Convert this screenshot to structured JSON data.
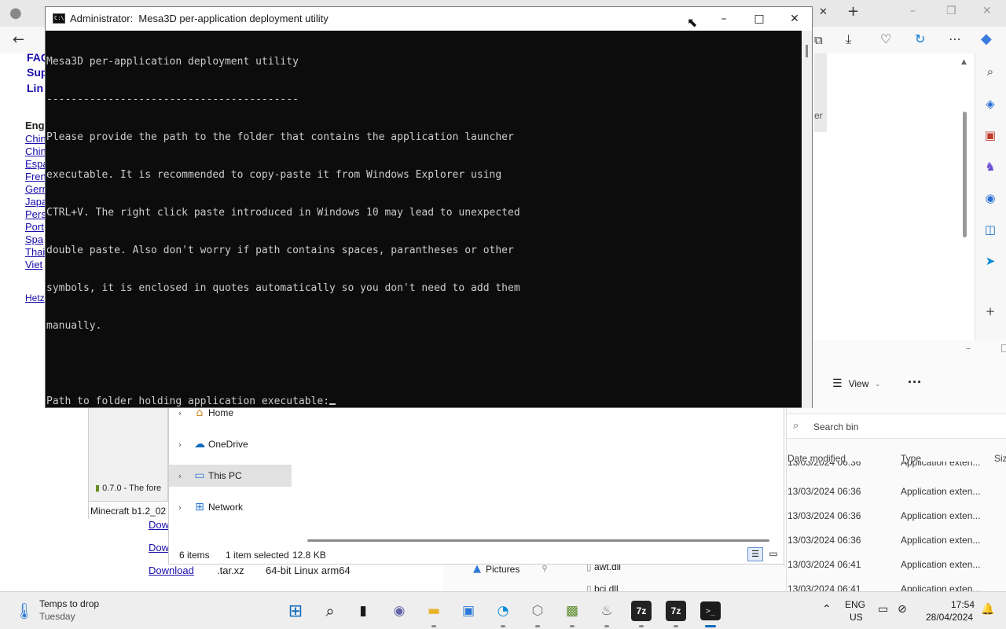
{
  "console": {
    "title": "Administrator:  Mesa3D per-application deployment utility",
    "lines": [
      "Mesa3D per-application deployment utility",
      "-----------------------------------------",
      "Please provide the path to the folder that contains the application launcher",
      "executable. It is recommended to copy-paste it from Windows Explorer using",
      "CTRL+V. The right click paste introduced in Windows 10 may lead to unexpected",
      "double paste. Also don't worry if path contains spaces, parantheses or other",
      "symbols, it is enclosed in quotes automatically so you don't need to add them",
      "manually.",
      "",
      "Path to folder holding application executable:"
    ],
    "minimize": "–",
    "maximize": "□",
    "close": "✕"
  },
  "browser": {
    "page_links_bold": [
      "FAQ",
      "Sup",
      "Lin"
    ],
    "heading": "Eng",
    "language_links": [
      "Chin",
      "Chin",
      "Espa",
      "Fren",
      "Gern",
      "Japa",
      "Pers",
      "Port",
      "Spa",
      "Thai",
      "Viet"
    ],
    "footer_link": "Hetz",
    "partial_label": "er",
    "downloads": [
      {
        "link": "Dow",
        "ext": "",
        "desc": ""
      },
      {
        "link": "Dow",
        "ext": "",
        "desc": ""
      },
      {
        "link": "Download",
        "ext": ".tar.xz",
        "desc": "64-bit Linux arm64"
      }
    ]
  },
  "explorer": {
    "view_label": "View",
    "more_label": "···",
    "search_placeholder": "Search bin",
    "nav": [
      {
        "label": "Home",
        "icon": "home-icon"
      },
      {
        "label": "OneDrive",
        "icon": "onedrive-icon"
      },
      {
        "label": "This PC",
        "icon": "this-pc-icon"
      },
      {
        "label": "Network",
        "icon": "network-icon"
      }
    ],
    "quick_access": [
      {
        "label": "Pictures",
        "icon": "pictures-icon"
      }
    ],
    "status": {
      "items": "6 items",
      "selected": "1 item selected",
      "size": "12.8 KB"
    },
    "columns": {
      "date": "Date modified",
      "type": "Type",
      "size": "Siz"
    },
    "files": [
      {
        "name": "",
        "date": "13/03/2024 06:36",
        "type": "Application exten..."
      },
      {
        "name": "",
        "date": "13/03/2024 06:36",
        "type": "Application exten..."
      },
      {
        "name": "",
        "date": "13/03/2024 06:36",
        "type": "Application exten..."
      },
      {
        "name": "",
        "date": "13/03/2024 06:36",
        "type": "Application exten..."
      },
      {
        "name": "awt.dll",
        "date": "13/03/2024 06:41",
        "type": "Application exten..."
      },
      {
        "name": "bci.dll",
        "date": "13/03/2024 06:41",
        "type": "Application exten..."
      }
    ]
  },
  "minecraft": {
    "entry1": "0.7.0 - The fore",
    "entry2": "Minecraft b1.2_02 ("
  },
  "taskbar": {
    "weather_line1": "Temps to drop",
    "weather_line2": "Tuesday",
    "lang_line1": "ENG",
    "lang_line2": "US",
    "time": "17:54",
    "date": "28/04/2024",
    "app_7z": "7z"
  }
}
